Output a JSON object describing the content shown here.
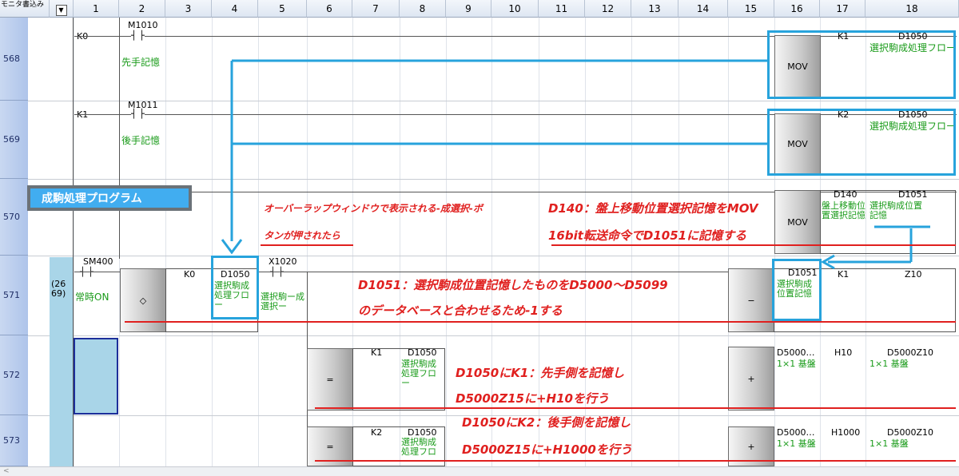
{
  "header": {
    "corner_label": "モニタ書込み",
    "dropdown_icon": "chevron-down-icon",
    "columns": [
      "1",
      "2",
      "3",
      "4",
      "5",
      "6",
      "7",
      "8",
      "9",
      "10",
      "11",
      "12",
      "13",
      "14",
      "15",
      "16",
      "17",
      "18"
    ]
  },
  "rows": {
    "numbers": [
      "568",
      "569",
      "570",
      "571",
      "572",
      "573"
    ],
    "step_571": "(26\n69)"
  },
  "r568": {
    "k": "K0",
    "contact": "M1010",
    "comment": "先手記憶",
    "inst": "MOV",
    "op1": "K1",
    "op2": "D1050",
    "op2_comment": "選択駒成処理フロー"
  },
  "r569": {
    "k": "K1",
    "contact": "M1011",
    "comment": "後手記憶",
    "inst": "MOV",
    "op1": "K2",
    "op2": "D1050",
    "op2_comment": "選択駒成処理フロー"
  },
  "r570": {
    "inst": "MOV",
    "op1": "D140",
    "op1_comment": "盤上移動位置選択記憶",
    "op2": "D1051",
    "op2_comment": "選択駒成位置記憶"
  },
  "r571": {
    "contact": "SM400",
    "contact_comment": "常時ON",
    "cmp": "◇",
    "cmp_op1": "K0",
    "cmp_op2": "D1050",
    "cmp_op2_comment": "選択駒成処理フロー",
    "contact2": "X1020",
    "contact2_comment": "選択駒ー成選択ー",
    "inst": "−",
    "op1": "D1051",
    "op1_comment": "選択駒成位置記憶",
    "op2": "K1",
    "op3": "Z10"
  },
  "r572": {
    "cmp": "=",
    "cmp_op1": "K1",
    "cmp_op2": "D1050",
    "cmp_op2_comment": "選択駒成処理フロー",
    "inst": "+",
    "op1": "D5000…",
    "op1_comment": "1×1 基盤",
    "op2": "H10",
    "op3": "D5000Z10",
    "op3_comment": "1×1 基盤"
  },
  "r573": {
    "cmp": "=",
    "cmp_op1": "K2",
    "cmp_op2": "D1050",
    "cmp_op2_comment": "選択駒成処理フロー",
    "inst": "+",
    "op1": "D5000…",
    "op1_comment": "1×1 基盤",
    "op2": "H1000",
    "op3": "D5000Z10",
    "op3_comment": "1×1 基盤"
  },
  "annotations": {
    "title_label": "成駒処理プログラム",
    "note_570_a": "オーバーラップウィンドウで表示される-成選択-ボ",
    "note_570_b": "タンが押されたら",
    "note_570_c": "D140：盤上移動位置選択記憶をMOV",
    "note_570_d": "16bit転送命令でD1051に記憶する",
    "note_571_a": "D1051：選択駒成位置記憶したものをD5000～D5099",
    "note_571_b": "のデータベースと合わせるため-1する",
    "note_572_a": "D1050にK1：先手側を記憶し",
    "note_572_b": "D5000Z15に+H10を行う",
    "note_573_a": "D1050にK2：後手側を記憶し",
    "note_573_b": "D5000Z15に+H1000を行う"
  },
  "colors": {
    "annotation_blue": "#27a3dc",
    "annotation_red": "#e0201f",
    "comment_green": "#1a9b1a",
    "row_header": "#aec4ea"
  },
  "statusbar": {
    "scroll_hint": "<"
  }
}
